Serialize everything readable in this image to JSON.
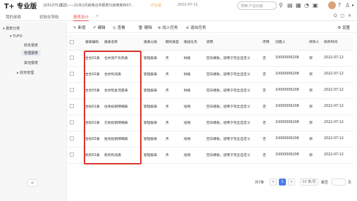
{
  "topbar": {
    "logo": "T+ 专业版",
    "org": "[631375]集团——21年1月启用合并报表只启用库存07...",
    "auth": "已认证",
    "date": "2022-07-11",
    "search_placeholder": "搜索-产品功能",
    "icons": [
      "search-icon",
      "doc-icon",
      "calendar-icon",
      "bell-icon",
      "grid-icon",
      "avatar",
      "question-icon",
      "user-icon",
      "logout-icon"
    ]
  },
  "tabs": {
    "items": [
      {
        "label": "我的桌面"
      },
      {
        "label": "初始化导航"
      },
      {
        "label": "报表设计"
      }
    ],
    "close": "×",
    "controls": "Q □ ✕"
  },
  "sidebar": {
    "items": [
      {
        "label": "▾ 报表分类"
      },
      {
        "label": "▾ TUFO"
      },
      {
        "label": "财务报表"
      },
      {
        "label": "管理报表"
      },
      {
        "label": "其他报表"
      },
      {
        "label": "▸ 财务管理"
      }
    ],
    "collapse": "<"
  },
  "toolbar": {
    "buttons": [
      {
        "icon": "✎",
        "label": "新增"
      },
      {
        "icon": "✐",
        "label": "编辑"
      },
      {
        "icon": "◎",
        "label": "查看"
      },
      {
        "icon": "🗑",
        "label": "删除"
      },
      {
        "icon": "⊕",
        "label": "加入任务"
      },
      {
        "icon": "⊖",
        "label": "退出任务"
      }
    ],
    "settings": "⚙ 设置"
  },
  "table": {
    "headers": [
      "",
      "报表编码",
      "报表名称",
      "报表分类",
      "期间类型",
      "报送任务",
      "说明",
      "停用",
      "创建人",
      "修改人",
      "修改时间"
    ],
    "rows": [
      [
        "",
        "合合01表",
        "合并资产负债表",
        "管理报表",
        "月",
        "财报",
        "空白模板，适用于完全自定义",
        "否",
        "10000006208",
        "郭",
        "2022-07-12"
      ],
      [
        "",
        "合合02表",
        "合并利润表",
        "管理报表",
        "月",
        "财报",
        "空白模板，适用于完全自定义",
        "否",
        "10000006208",
        "郭",
        "2022-07-12"
      ],
      [
        "",
        "合合03表",
        "合并现金流量表",
        "管理报表",
        "月",
        "财报",
        "空白模板，适用于完全自定义",
        "否",
        "10000006208",
        "郭",
        "2022-07-12"
      ],
      [
        "",
        "合抵01表",
        "往来抵销明细表",
        "管理报表",
        "月",
        "抵销",
        "空白模板，适用于完全自定义",
        "否",
        "10000006208",
        "郭",
        "2022-07-12"
      ],
      [
        "",
        "合抵02表",
        "交易抵销明细表",
        "管理报表",
        "月",
        "抵销",
        "空白模板，适用于完全自定义",
        "否",
        "10000006208",
        "郭",
        "2022-07-12"
      ],
      [
        "",
        "合抵03表",
        "投资抵销明细表",
        "管理报表",
        "月",
        "抵销",
        "空白模板，适用于完全自定义",
        "否",
        "10000006208",
        "郭",
        "2022-07-12"
      ],
      [
        "",
        "机构01表",
        "机构利润表",
        "管理报表",
        "月",
        "抵销",
        "空白模板，适用于完全自定义",
        "否",
        "10000006208",
        "郭",
        "2022-07-12"
      ]
    ]
  },
  "pager": {
    "total": "共7条",
    "prev": "<",
    "page": "1",
    "next": ">",
    "page_size": "10 条/页",
    "goto_label": "跳至",
    "goto_unit": "页"
  },
  "colors": {
    "accent": "#e55",
    "highlight": "#d9342b",
    "page_active": "#4a7cf0"
  }
}
